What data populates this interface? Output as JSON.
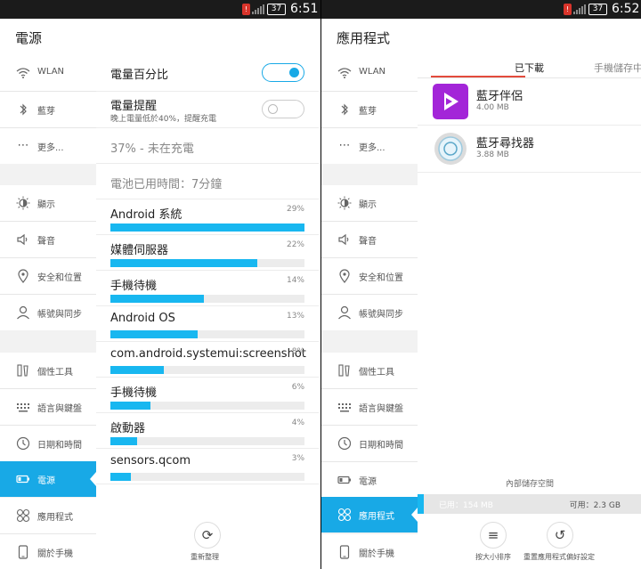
{
  "left": {
    "status": {
      "battery": "37",
      "time": "6:51"
    },
    "title": "電源",
    "rows": {
      "battery_percent_label": "電量百分比",
      "battery_alert_label": "電量提醒",
      "battery_alert_desc": "晚上電量低於40%，提醒充電",
      "battery_state": "37% - 未在充電",
      "battery_time": "電池已用時間：7分鐘"
    },
    "toggles": {
      "battery_percent": true,
      "battery_alert": false
    },
    "usage": [
      {
        "name": "Android 系統",
        "pct_label": "29%",
        "value": 29
      },
      {
        "name": "媒體伺服器",
        "pct_label": "22%",
        "value": 22
      },
      {
        "name": "手機待機",
        "pct_label": "14%",
        "value": 14
      },
      {
        "name": "Android OS",
        "pct_label": "13%",
        "value": 13
      },
      {
        "name": "com.android.systemui:screenshot",
        "pct_label": "8%",
        "value": 8
      },
      {
        "name": "手機待機",
        "pct_label": "6%",
        "value": 6
      },
      {
        "name": "啟動器",
        "pct_label": "4%",
        "value": 4
      },
      {
        "name": "sensors.qcom",
        "pct_label": "3%",
        "value": 3
      }
    ],
    "refresh_label": "重新整理"
  },
  "right": {
    "status": {
      "battery": "37",
      "time": "6:52"
    },
    "title": "應用程式",
    "tabs": [
      "已下載",
      "手機儲存中"
    ],
    "apps": [
      {
        "name": "藍牙伴侶",
        "size": "4.00 MB"
      },
      {
        "name": "藍牙尋找器",
        "size": "3.88 MB"
      }
    ],
    "storage": {
      "label": "內部儲存空間",
      "used": "已用：154 MB",
      "free": "可用：2.3 GB",
      "used_fraction": 0.03
    },
    "sort_label": "按大小排序",
    "reset_label": "重置應用程式偏好設定"
  },
  "nav": [
    {
      "label": "WLAN",
      "icon": "wifi-icon"
    },
    {
      "label": "藍芽",
      "icon": "bluetooth-icon"
    },
    {
      "label": "更多...",
      "icon": "more-icon"
    },
    {
      "label": "顯示",
      "icon": "display-icon"
    },
    {
      "label": "聲音",
      "icon": "sound-icon"
    },
    {
      "label": "安全和位置",
      "icon": "location-icon"
    },
    {
      "label": "帳號與同步",
      "icon": "account-icon"
    },
    {
      "label": "個性工具",
      "icon": "tools-icon"
    },
    {
      "label": "語言與鍵盤",
      "icon": "keyboard-icon"
    },
    {
      "label": "日期和時間",
      "icon": "clock-icon"
    },
    {
      "label": "電源",
      "icon": "battery-icon"
    },
    {
      "label": "應用程式",
      "icon": "apps-icon"
    },
    {
      "label": "關於手機",
      "icon": "phone-icon"
    }
  ],
  "colors": {
    "accent": "#18a9e6",
    "bar": "#18b7f0",
    "tab_indicator": "#e34b3c"
  }
}
